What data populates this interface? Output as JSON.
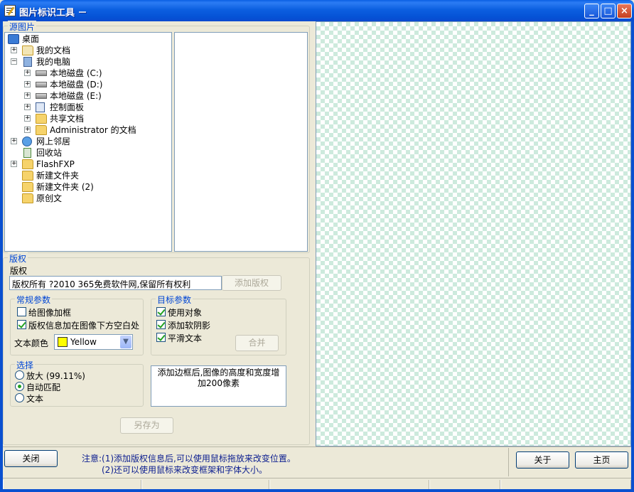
{
  "window": {
    "title": "图片标识工具 －"
  },
  "titlebar_buttons": {
    "minimize": "_",
    "maximize": "□",
    "close": "×"
  },
  "source": {
    "legend": "源图片"
  },
  "tree": [
    {
      "label": "桌面",
      "icon": "desktop-icon"
    },
    {
      "label": "我的文档",
      "icon": "my-documents-icon"
    },
    {
      "label": "我的电脑",
      "icon": "my-computer-icon"
    },
    {
      "label": "本地磁盘 (C:)",
      "icon": "drive-icon"
    },
    {
      "label": "本地磁盘 (D:)",
      "icon": "drive-icon"
    },
    {
      "label": "本地磁盘 (E:)",
      "icon": "drive-icon"
    },
    {
      "label": "控制面板",
      "icon": "control-panel-icon"
    },
    {
      "label": "共享文档",
      "icon": "folder-icon"
    },
    {
      "label": "Administrator 的文档",
      "icon": "folder-icon"
    },
    {
      "label": "网上邻居",
      "icon": "network-icon"
    },
    {
      "label": "回收站",
      "icon": "recycle-bin-icon"
    },
    {
      "label": "FlashFXP",
      "icon": "folder-icon"
    },
    {
      "label": "新建文件夹",
      "icon": "folder-icon"
    },
    {
      "label": "新建文件夹 (2)",
      "icon": "folder-icon"
    },
    {
      "label": "原创文",
      "icon": "folder-icon"
    }
  ],
  "copyright": {
    "legend": "版权",
    "label": "版权",
    "value": "版权所有 ?2010 365免费软件网,保留所有权利",
    "add_button": "添加版权"
  },
  "general": {
    "legend": "常规参数",
    "add_border": "给图像加框",
    "info_below": "版权信息加在图像下方空白处",
    "text_color_label": "文本颜色",
    "text_color_value": "Yellow",
    "text_color_swatch": "#ffff00"
  },
  "target": {
    "legend": "目标参数",
    "use_object": "使用对象",
    "soft_shadow": "添加软阴影",
    "smooth_text": "平滑文本",
    "merge_button": "合并"
  },
  "select": {
    "legend": "选择",
    "zoom": "放大 (99.11%)",
    "auto_fit": "自动匹配",
    "text": "文本"
  },
  "note_box": "添加边框后,图像的高度和宽度增加200像素",
  "save_as": "另存为",
  "footer": {
    "close": "关闭",
    "note1": "注意:(1)添加版权信息后,可以使用鼠标拖放来改变位置。",
    "note2": "(2)还可以使用鼠标来改变框架和字体大小。",
    "about": "关于",
    "home": "主页"
  }
}
